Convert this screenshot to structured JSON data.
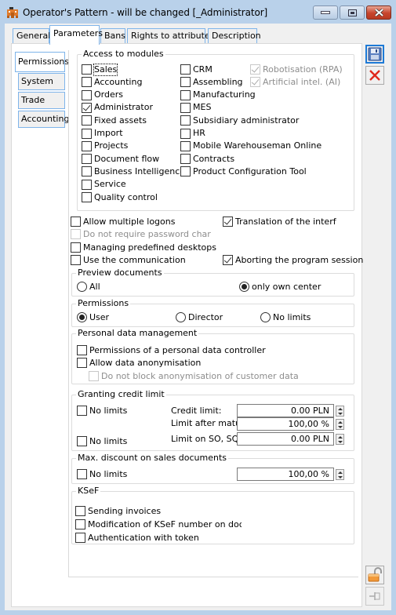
{
  "window": {
    "title": "Operator's Pattern - will be changed [_Administrator]",
    "icon": "operator-pattern-icon",
    "controls": [
      "minimize",
      "maximize",
      "close"
    ]
  },
  "tabs": [
    {
      "label": "General",
      "active": false
    },
    {
      "label": "Parameters",
      "active": true
    },
    {
      "label": "Bans",
      "active": false
    },
    {
      "label": "Rights to attributes",
      "active": false
    },
    {
      "label": "Description",
      "active": false
    }
  ],
  "side_tabs": [
    {
      "label": "Permissions",
      "active": true
    },
    {
      "label": "System",
      "active": false
    },
    {
      "label": "Trade",
      "active": false
    },
    {
      "label": "Accounting",
      "active": false
    }
  ],
  "access_modules": {
    "title": "Access to modules",
    "col1": [
      {
        "label": "Sales",
        "checked": false
      },
      {
        "label": "Accounting",
        "checked": false
      },
      {
        "label": "Orders",
        "checked": false
      },
      {
        "label": "Administrator",
        "checked": true
      },
      {
        "label": "Fixed assets",
        "checked": false
      },
      {
        "label": "Import",
        "checked": false
      },
      {
        "label": "Projects",
        "checked": false
      },
      {
        "label": "Document flow",
        "checked": false
      },
      {
        "label": "Business Intelligence",
        "checked": false
      },
      {
        "label": "Service",
        "checked": false
      },
      {
        "label": "Quality control",
        "checked": false
      }
    ],
    "col2": [
      {
        "label": "CRM",
        "checked": false
      },
      {
        "label": "Assembling",
        "checked": false
      },
      {
        "label": "Manufacturing",
        "checked": false
      },
      {
        "label": "MES",
        "checked": false
      },
      {
        "label": "Subsidiary administrator",
        "checked": false
      },
      {
        "label": "HR",
        "checked": false
      },
      {
        "label": "Mobile Warehouseman Online",
        "checked": false
      },
      {
        "label": "Contracts",
        "checked": false
      },
      {
        "label": "Product Configuration Tool",
        "checked": false
      }
    ],
    "col3": [
      {
        "label": "Robotisation (RPA)",
        "checked": true,
        "disabled": true
      },
      {
        "label": "Artificial intel. (AI)",
        "checked": true,
        "disabled": true
      }
    ]
  },
  "general_options": {
    "allow_multiple_logons": {
      "label": "Allow multiple logons",
      "checked": false
    },
    "do_not_require_password": {
      "label": "Do not require password char",
      "checked": false,
      "disabled": true
    },
    "managing_desktops": {
      "label": "Managing predefined desktops",
      "checked": false
    },
    "use_communication": {
      "label": "Use the communication",
      "checked": false
    },
    "translation_interface": {
      "label": "Translation of the interf",
      "checked": true
    },
    "aborting_session": {
      "label": "Aborting the program session",
      "checked": true
    }
  },
  "preview_documents": {
    "title": "Preview documents",
    "options": [
      {
        "label": "All",
        "selected": false
      },
      {
        "label": "only own center",
        "selected": true
      }
    ]
  },
  "permissions": {
    "title": "Permissions",
    "options": [
      {
        "label": "User",
        "selected": true
      },
      {
        "label": "Director",
        "selected": false
      },
      {
        "label": "No limits",
        "selected": false
      }
    ]
  },
  "personal_data": {
    "title": "Personal data management",
    "controller": {
      "label": "Permissions of a personal data controller",
      "checked": false
    },
    "anonymisation": {
      "label": "Allow data anonymisation",
      "checked": false
    },
    "no_block": {
      "label": "Do not block anonymisation of customer data",
      "checked": false,
      "disabled": true
    }
  },
  "credit_limit": {
    "title": "Granting credit limit",
    "no_limits_1": {
      "label": "No limits",
      "checked": false
    },
    "no_limits_2": {
      "label": "No limits",
      "checked": false
    },
    "credit_limit_label": "Credit limit:",
    "credit_limit_value": "0.00 PLN",
    "limit_after_label": "Limit after maturit",
    "limit_after_value": "100,00 %",
    "limit_so_label": "Limit on SO, SQ:",
    "limit_so_value": "0.00 PLN"
  },
  "max_discount": {
    "title": "Max. discount on sales documents",
    "no_limits": {
      "label": "No limits",
      "checked": false
    },
    "value": "100,00 %"
  },
  "ksef": {
    "title": "KSeF",
    "sending": {
      "label": "Sending invoices",
      "checked": false
    },
    "modification": {
      "label": "Modification of KSeF number on documen",
      "checked": false
    },
    "authentication": {
      "label": "Authentication with token",
      "checked": false
    }
  },
  "toolbar": {
    "save": "save-icon",
    "cancel": "cancel-icon",
    "lock": "padlock-open-icon",
    "pin": "pin-icon"
  }
}
